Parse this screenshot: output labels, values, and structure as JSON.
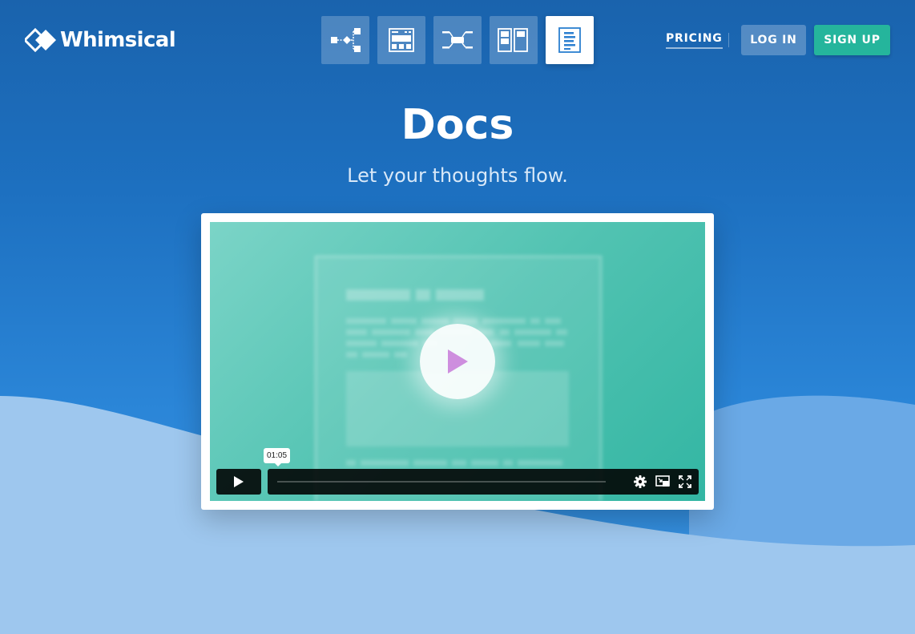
{
  "brand": {
    "name": "Whimsical"
  },
  "toolbar": {
    "items": [
      {
        "id": "flowcharts",
        "icon": "flowchart-icon",
        "active": false
      },
      {
        "id": "wireframes",
        "icon": "wireframe-icon",
        "active": false
      },
      {
        "id": "mind-maps",
        "icon": "mindmap-icon",
        "active": false
      },
      {
        "id": "sticky-notes",
        "icon": "sticky-notes-icon",
        "active": false
      },
      {
        "id": "docs",
        "icon": "doc-icon",
        "active": true
      }
    ]
  },
  "nav": {
    "pricing": "PRICING",
    "login": "LOG IN",
    "signup": "SIGN UP"
  },
  "hero": {
    "title": "Docs",
    "subtitle": "Let your thoughts flow."
  },
  "video": {
    "time_tooltip": "01:05",
    "progress": 0
  },
  "colors": {
    "accent": "#25b59c",
    "background": "#1d70c0",
    "video_tint": "#52c3b2",
    "play_glyph": "#c77ad8"
  }
}
